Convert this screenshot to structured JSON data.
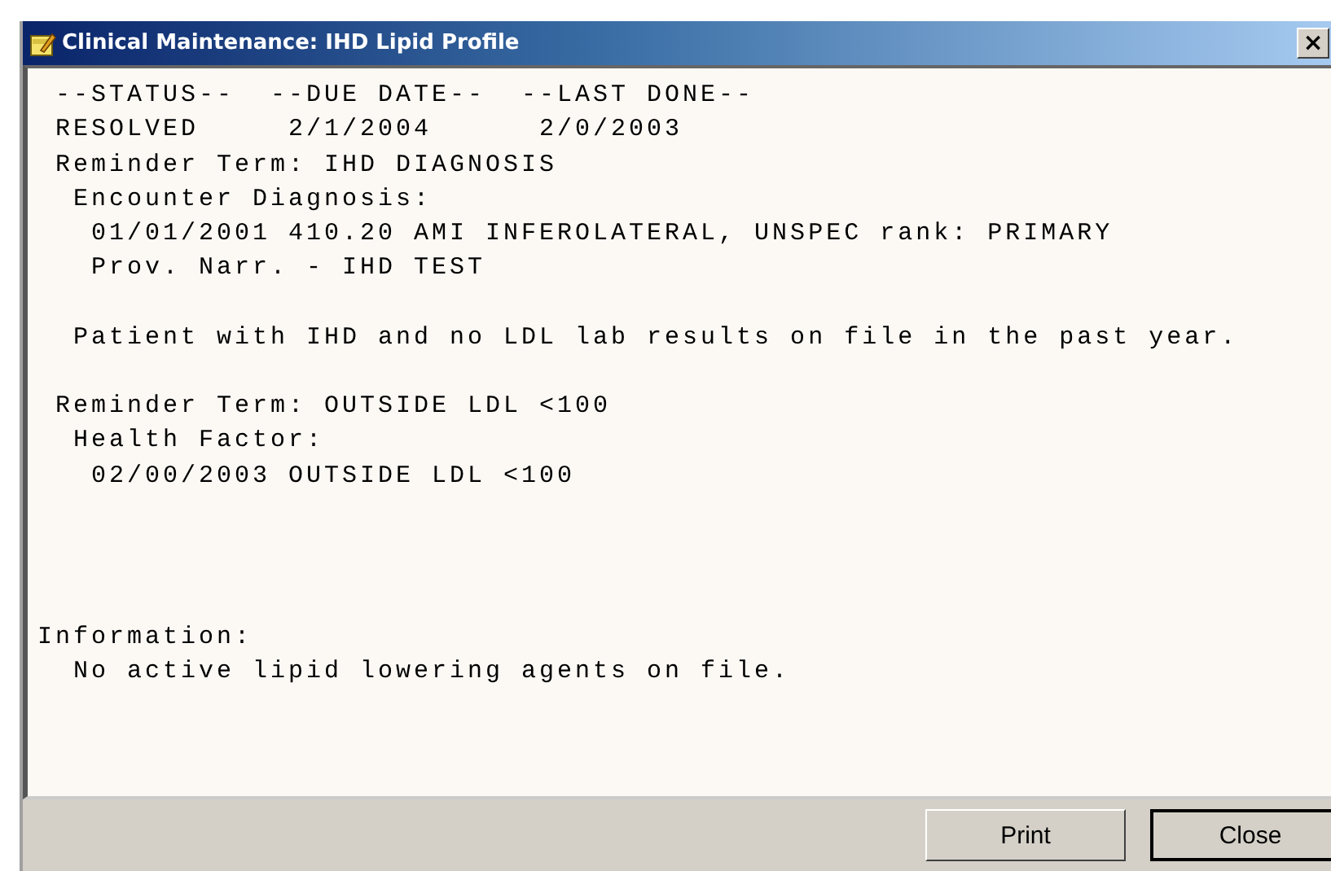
{
  "window": {
    "title": "Clinical Maintenance: IHD Lipid Profile",
    "close_glyph": "×"
  },
  "blocks": [
    {
      "kind": "header",
      "lines": [
        " --STATUS--  --DUE DATE--  --LAST DONE--",
        " RESOLVED     2/1/2004      2/0/2003",
        " Reminder Term: IHD DIAGNOSIS",
        "  Encounter Diagnosis:",
        "   01/01/2001 410.20 AMI INFEROLATERAL, UNSPEC rank: PRIMARY",
        "   Prov. Narr. - IHD TEST"
      ]
    },
    {
      "kind": "message",
      "lines": [
        "  Patient with IHD and no LDL lab results on file in the past year."
      ]
    },
    {
      "kind": "term",
      "lines": [
        " Reminder Term: OUTSIDE LDL <100",
        "  Health Factor:",
        "   02/00/2003 OUTSIDE LDL <100"
      ]
    },
    {
      "kind": "information",
      "lines": [
        "Information:",
        "  No active lipid lowering agents on file."
      ]
    }
  ],
  "buttons": [
    "Print",
    "Close"
  ]
}
